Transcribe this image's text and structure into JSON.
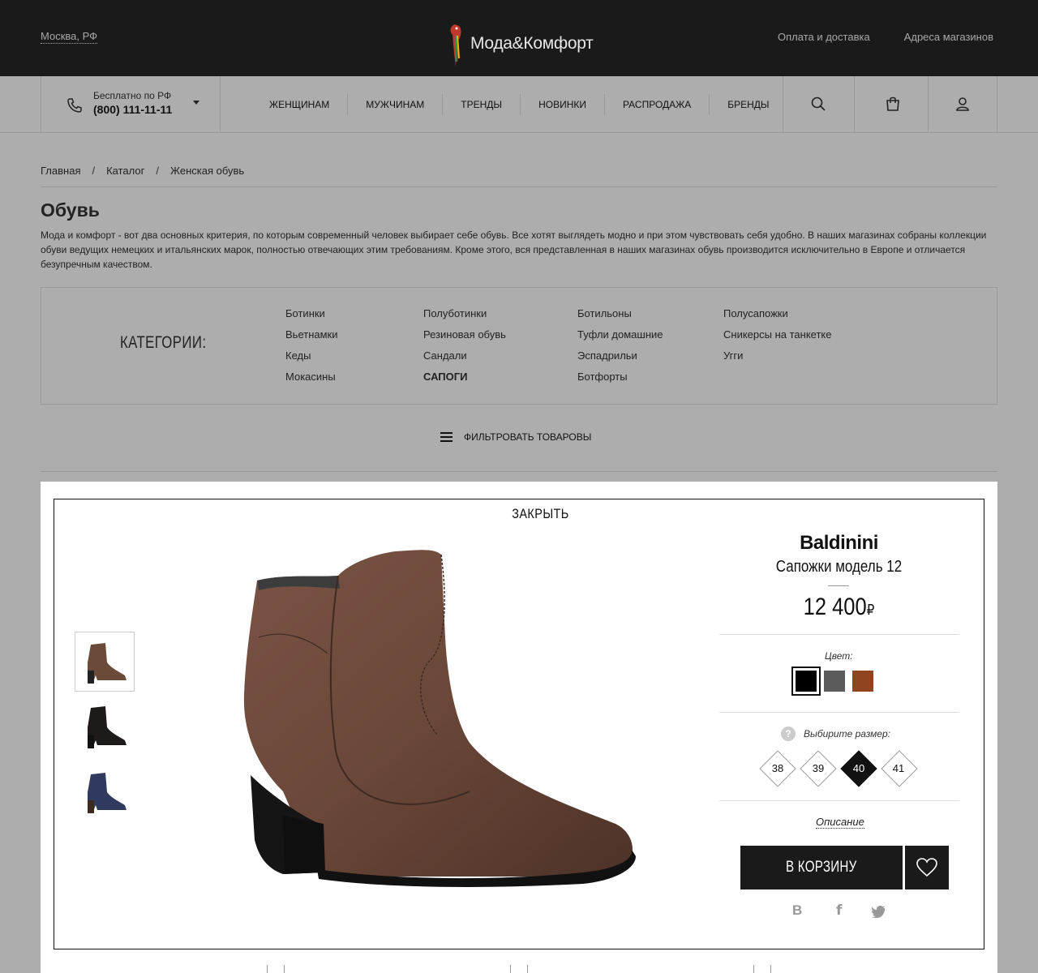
{
  "header": {
    "city": "Москва, РФ",
    "logo_text": "Мода&Комфорт",
    "links": [
      "Оплата и доставка",
      "Адреса магазинов"
    ]
  },
  "nav": {
    "phone_caption": "Бесплатно по РФ",
    "phone_number": "(800) 111-11-11",
    "menu": [
      "ЖЕНЩИНАМ",
      "МУЖЧИНАМ",
      "ТРЕНДЫ",
      "НОВИНКИ",
      "РАСПРОДАЖА",
      "БРЕНДЫ"
    ],
    "icons": [
      "search-icon",
      "bag-icon",
      "user-icon"
    ]
  },
  "breadcrumb": [
    "Главная",
    "Каталог",
    "Женская обувь"
  ],
  "page": {
    "title": "Обувь",
    "description": "Мода и комфорт - вот два основных критерия, по которым современный человек выбирает себе обувь. Все хотят выглядеть модно и при этом чувствовать себя удобно. В наших магазинах собраны коллекции обуви ведущих немецких и итальянских марок, полностью отвечающих этим требованиям. Кроме этого, вся представленная в наших магазинах обувь производится исключительно в Европе и отличается безупречным качеством."
  },
  "categories": {
    "title": "КАТЕГОРИИ:",
    "columns": [
      [
        "Ботинки",
        "Вьетнамки",
        "Кеды",
        "Мокасины"
      ],
      [
        "Полуботинки",
        "Резиновая обувь",
        "Сандали",
        "САПОГИ"
      ],
      [
        "Ботильоны",
        "Туфли домашние",
        "Эспадрильи",
        "Ботфорты"
      ],
      [
        "Полусапожки",
        "Сникерсы на танкетке",
        "Угги"
      ]
    ],
    "active": "САПОГИ"
  },
  "filter": {
    "label": "ФИЛЬТРОВАТЬ ТОВАРОВЫ"
  },
  "product": {
    "close_label": "ЗАКРЫТЬ",
    "brand": "Baldinini",
    "model": "Сапожки модель 12",
    "price": "12 400",
    "currency": "₽",
    "color_label": "Цвет:",
    "colors": [
      "#000000",
      "#5b5b5b",
      "#8f4520"
    ],
    "selected_color": 0,
    "size_label": "Выбирите размер:",
    "sizes": [
      "38",
      "39",
      "40",
      "41"
    ],
    "selected_size": "40",
    "description_link": "Описание",
    "cart_button": "В КОРЗИНУ",
    "social": [
      "В",
      "f",
      "twitter-icon"
    ],
    "thumbnails": [
      "brown",
      "black",
      "navy"
    ]
  }
}
